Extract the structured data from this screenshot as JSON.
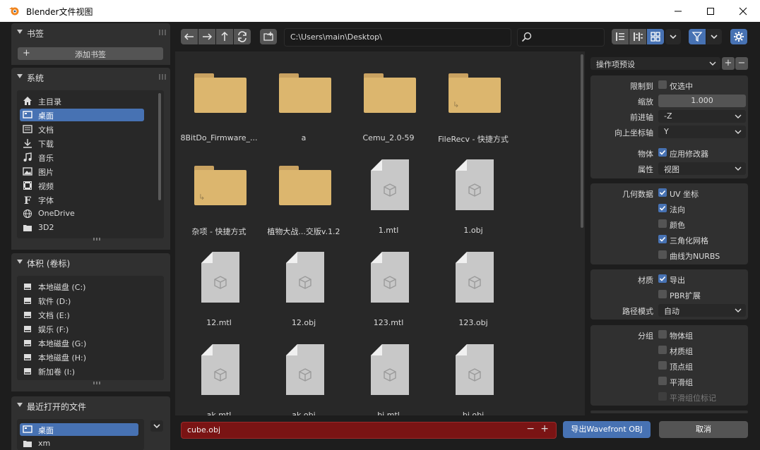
{
  "window": {
    "title": "Blender文件视图"
  },
  "bookmarks": {
    "header": "书签",
    "add_label": "添加书签"
  },
  "system": {
    "header": "系统",
    "items": [
      {
        "label": "主目录",
        "icon": "home-icon"
      },
      {
        "label": "桌面",
        "icon": "desktop-icon"
      },
      {
        "label": "文档",
        "icon": "documents-icon"
      },
      {
        "label": "下载",
        "icon": "download-icon"
      },
      {
        "label": "音乐",
        "icon": "music-icon"
      },
      {
        "label": "图片",
        "icon": "image-icon"
      },
      {
        "label": "视频",
        "icon": "video-icon"
      },
      {
        "label": "字体",
        "icon": "font-icon"
      },
      {
        "label": "OneDrive",
        "icon": "globe-icon"
      },
      {
        "label": "3D2",
        "icon": "folder-icon"
      }
    ]
  },
  "volumes": {
    "header": "体积 (卷标)",
    "items": [
      {
        "label": "本地磁盘 (C:)"
      },
      {
        "label": "软件 (D:)"
      },
      {
        "label": "文档 (E:)"
      },
      {
        "label": "娱乐 (F:)"
      },
      {
        "label": "本地磁盘 (G:)"
      },
      {
        "label": "本地磁盘 (H:)"
      },
      {
        "label": "新加卷 (I:)"
      }
    ]
  },
  "recent": {
    "header": "最近打开的文件",
    "items": [
      {
        "label": "桌面"
      },
      {
        "label": "xm"
      }
    ]
  },
  "toolbar": {
    "path": "C:\\Users\\main\\Desktop\\",
    "search": ""
  },
  "files": [
    {
      "name": "8BitDo_Firmware_...",
      "kind": "folder",
      "link": false
    },
    {
      "name": "a",
      "kind": "folder",
      "link": false
    },
    {
      "name": "Cemu_2.0-59",
      "kind": "folder",
      "link": false
    },
    {
      "name": "FileRecv - 快捷方式",
      "kind": "folder",
      "link": true
    },
    {
      "name": "杂项 - 快捷方式",
      "kind": "folder",
      "link": true
    },
    {
      "name": "植物大战...交版v.1.2",
      "kind": "folder",
      "link": false
    },
    {
      "name": "1.mtl",
      "kind": "file"
    },
    {
      "name": "1.obj",
      "kind": "file"
    },
    {
      "name": "12.mtl",
      "kind": "file"
    },
    {
      "name": "12.obj",
      "kind": "file"
    },
    {
      "name": "123.mtl",
      "kind": "file"
    },
    {
      "name": "123.obj",
      "kind": "file"
    },
    {
      "name": "ak.mtl",
      "kind": "file"
    },
    {
      "name": "ak.obj",
      "kind": "file"
    },
    {
      "name": "bj.mtl",
      "kind": "file"
    },
    {
      "name": "bj.obj",
      "kind": "file"
    }
  ],
  "operator": {
    "preset_label": "操作项预设",
    "limit": {
      "label": "限制到",
      "option": "仅选中",
      "checked": false
    },
    "scale": {
      "label": "缩放",
      "value": "1.000"
    },
    "forward": {
      "label": "前进轴",
      "value": "-Z"
    },
    "up": {
      "label": "向上坐标轴",
      "value": "Y"
    },
    "object": {
      "label": "物体",
      "option": "应用修改器",
      "checked": true
    },
    "props": {
      "label": "属性",
      "value": "视图"
    },
    "geometry": {
      "label": "几何数据",
      "options": [
        {
          "label": "UV 坐标",
          "checked": true
        },
        {
          "label": "法向",
          "checked": true
        },
        {
          "label": "颜色",
          "checked": false
        },
        {
          "label": "三角化网格",
          "checked": true
        },
        {
          "label": "曲线为NURBS",
          "checked": false
        }
      ]
    },
    "materials": {
      "label": "材质",
      "export": "导出",
      "export_checked": true,
      "pbr": "PBR扩展",
      "pbr_checked": false,
      "path_label": "路径模式",
      "path_value": "自动"
    },
    "groups": {
      "label": "分组",
      "options": [
        {
          "label": "物体组",
          "checked": false
        },
        {
          "label": "材质组",
          "checked": false
        },
        {
          "label": "顶点组",
          "checked": false
        },
        {
          "label": "平滑组",
          "checked": false
        },
        {
          "label": "平滑组位标记",
          "checked": false,
          "disabled": true
        }
      ]
    }
  },
  "bottom": {
    "filename": "cube.obj",
    "export_label": "导出Wavefront OBJ",
    "cancel_label": "取消"
  },
  "colors": {
    "accent": "#4772b3",
    "filename_bg": "#7a1414",
    "folder": "#dcb66e"
  }
}
